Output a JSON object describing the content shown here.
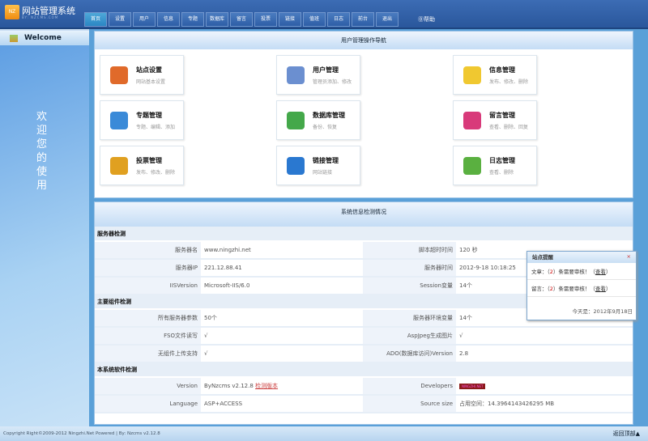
{
  "header": {
    "title": "网站管理系统",
    "subtitle": "BY: NZCMS.COM",
    "logo_text": "NZ",
    "help": "帮助",
    "tabs": [
      "首页",
      "设置",
      "用户",
      "信息",
      "专题",
      "数据库",
      "留言",
      "投票",
      "链接",
      "值班",
      "日志",
      "前台",
      "退出"
    ]
  },
  "sidebar": {
    "welcome": "Welcome",
    "vertical_text": "欢迎您的使用"
  },
  "nav": {
    "title": "用户管理操作导航",
    "cards": [
      {
        "title": "站点设置",
        "desc": "网站基本设置",
        "color": "#e06a2a"
      },
      {
        "title": "用户管理",
        "desc": "管理员添加、修改",
        "color": "#6b8fd0"
      },
      {
        "title": "信息管理",
        "desc": "发布、修改、删除",
        "color": "#f0c830"
      },
      {
        "title": "专题管理",
        "desc": "专题、编辑、添加",
        "color": "#3a8ad8"
      },
      {
        "title": "数据库管理",
        "desc": "备份、恢复",
        "color": "#44a84a"
      },
      {
        "title": "留言管理",
        "desc": "查看、删除、回复",
        "color": "#d83a7a"
      },
      {
        "title": "投票管理",
        "desc": "发布、修改、删除",
        "color": "#e0a020"
      },
      {
        "title": "链接管理",
        "desc": "网站链接",
        "color": "#2a78d0"
      },
      {
        "title": "日志管理",
        "desc": "查看、删除",
        "color": "#5ab040"
      }
    ]
  },
  "system": {
    "title": "系统信息检测情况",
    "sections": [
      {
        "title": "服务器检测",
        "rows": [
          [
            "服务器名",
            "www.ningzhi.net",
            "脚本超时时间",
            "120 秒"
          ],
          [
            "服务器IP",
            "221.12.88.41",
            "服务器时间",
            "2012-9-18 10:18:25"
          ],
          [
            "IISVersion",
            "Microsoft-IIS/6.0",
            "Session变量",
            "14个"
          ]
        ]
      },
      {
        "title": "主要组件检测",
        "rows": [
          [
            "所有服务器参数",
            "50个",
            "服务器环境变量",
            "14个"
          ],
          [
            "FSO文件读写",
            "√",
            "AspJpeg生成图片",
            "√"
          ],
          [
            "无组件上传支持",
            "√",
            "ADO(数据库访问)Version",
            "2.8"
          ]
        ]
      },
      {
        "title": "本系统软件检测",
        "rows": [
          [
            "Version",
            "ByNzcms v2.12.8",
            "Developers",
            "NINGZHI.NET"
          ],
          [
            "Language",
            "ASP+ACCESS",
            "Source size",
            "占用空间：14.3964143426295 MB"
          ]
        ]
      }
    ],
    "check_version": "检测版本"
  },
  "popup": {
    "title": "站点提醒",
    "close": "×",
    "rows": [
      {
        "label": "文章：（",
        "count": "2",
        "text": "）条需要审核！（",
        "link": "查看",
        "end": "）"
      },
      {
        "label": "留言：（",
        "count": "2",
        "text": "）条需要审核！（",
        "link": "查看",
        "end": "）"
      }
    ],
    "today": "今天是：2012年9月18日"
  },
  "footer": {
    "copyright": "Copyright Right©2009-2012 Ningzhi.Net Powered | By: Nzcms v2.12.8",
    "back_top": "返回顶部▲"
  }
}
